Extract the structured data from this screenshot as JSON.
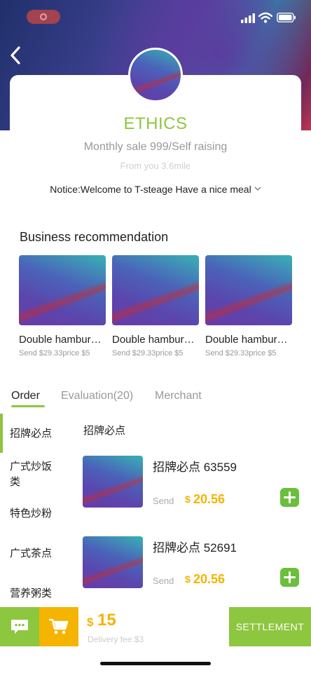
{
  "shop": {
    "name": "ETHICS",
    "sales": "Monthly sale 999/Self raising",
    "distance": "From you 3.6mile",
    "notice": "Notice:Welcome to T-steage Have a nice meal"
  },
  "recommendation": {
    "title": "Business recommendation",
    "items": [
      {
        "name": "Double hamburger",
        "price": "Send $29.33price $5"
      },
      {
        "name": "Double hamburger",
        "price": "Send $29.33price $5"
      },
      {
        "name": "Double hamburger",
        "price": "Send $29.33price $5"
      }
    ]
  },
  "tabs": [
    {
      "label": "Order",
      "active": true
    },
    {
      "label": "Evaluation(20)",
      "active": false
    },
    {
      "label": "Merchant",
      "active": false
    }
  ],
  "categories": [
    "招牌必点",
    "广式炒饭类",
    "特色炒粉",
    "广式茶点",
    "营养粥类"
  ],
  "menu": {
    "category_title": "招牌必点",
    "dishes": [
      {
        "name": "招牌必点 63559",
        "send_label": "Send",
        "currency": "$",
        "price": "20.56"
      },
      {
        "name": "招牌必点 52691",
        "send_label": "Send",
        "currency": "$",
        "price": "20.56"
      }
    ]
  },
  "cart": {
    "currency": "$",
    "total": "15",
    "delivery_fee": "Delivery fee  $3",
    "settle_label": "SETTLEMENT"
  },
  "colors": {
    "accent": "#8dc63f",
    "price": "#f5b400",
    "add": "#6cbe3c"
  },
  "icons": [
    "back-arrow-icon",
    "chevron-down-icon",
    "chat-icon",
    "cart-icon",
    "plus-icon",
    "signal-icon",
    "wifi-icon",
    "battery-icon"
  ]
}
